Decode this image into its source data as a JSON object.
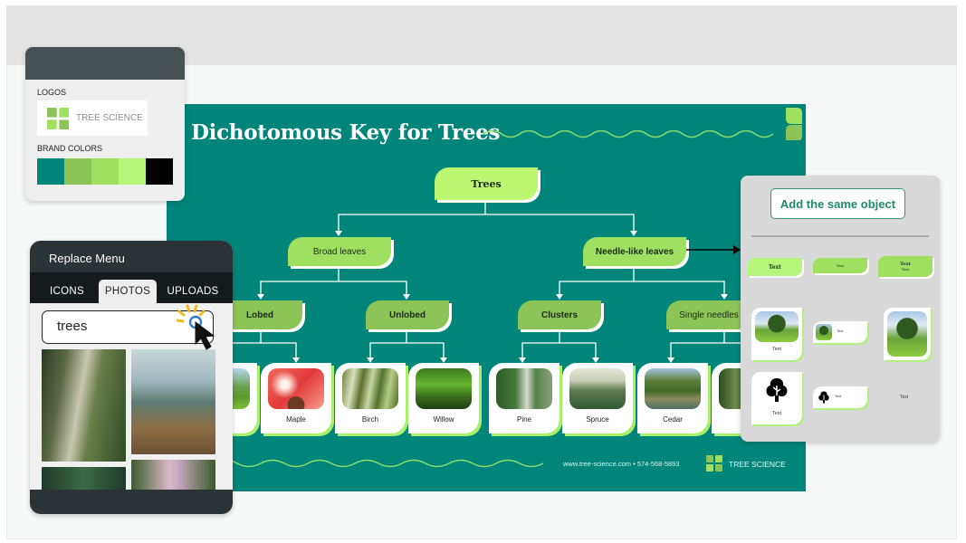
{
  "brand_kit": {
    "logos_label": "LOGOS",
    "logo_text": "TREE SCIENCE",
    "brand_colors_label": "BRAND COLORS",
    "colors": [
      "#00857a",
      "#8dc457",
      "#a0e060",
      "#b4f57a",
      "#000000"
    ]
  },
  "replace_menu": {
    "title": "Replace Menu",
    "tabs": [
      {
        "label": "ICONS",
        "active": false
      },
      {
        "label": "PHOTOS",
        "active": true
      },
      {
        "label": "UPLOADS",
        "active": false
      }
    ],
    "search_value": "trees",
    "results": [
      "forest-stream",
      "mountain-pines",
      "dark-forest",
      "rainbow-trees"
    ]
  },
  "canvas": {
    "title": "Dichotomous Key for Trees",
    "root": "Trees",
    "level1": [
      "Broad leaves",
      "Needle-like leaves"
    ],
    "level2": [
      "Lobed",
      "Unlobed",
      "Clusters",
      "Single needles"
    ],
    "leaves": [
      "",
      "Maple",
      "Birch",
      "Willow",
      "Pine",
      "Spruce",
      "Cedar",
      ""
    ],
    "footer_contact": "www.tree-science.com • 574-568-5893",
    "footer_brand": "TREE SCIENCE"
  },
  "same_object_panel": {
    "button_label": "Add the same object",
    "variant_text": "Text"
  },
  "colors": {
    "teal": "#00857a",
    "lime": "#bdf772",
    "green": "#a0e060",
    "olive_green": "#8dc457"
  }
}
